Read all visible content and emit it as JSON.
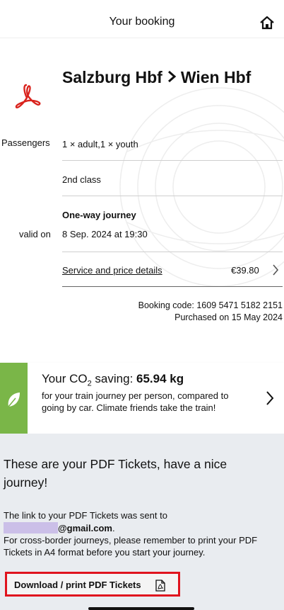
{
  "header": {
    "title": "Your booking",
    "home_icon": "home-icon"
  },
  "booking": {
    "from": "Salzburg Hbf",
    "to": "Wien Hbf",
    "passengers_label": "Passengers",
    "passengers_value": "1 × adult,1 × youth",
    "class": "2nd class",
    "journey_type": "One-way journey",
    "valid_label": "valid on",
    "valid_value": "8 Sep. 2024 at 19:30",
    "service_link": "Service and price details",
    "price": "€39.80",
    "booking_code": "Booking code: 1609 5471 5182 2151",
    "purchased": "Purchased on 15 May 2024"
  },
  "co2": {
    "title_prefix": "Your CO",
    "title_sub": "2",
    "title_mid": " saving: ",
    "amount": "65.94 kg",
    "description": "for your train journey per person, compared to going by car. Climate friends take the train!",
    "accent_color": "#7ab648"
  },
  "tickets": {
    "heading": "These are your PDF Tickets, have a nice journey!",
    "link_sent": "The link to your PDF Tickets was sent to",
    "email_domain": "@gmail.com",
    "email_suffix": ".",
    "cross_border": "For cross-border journeys, please remember to print your PDF Tickets in A4 format before you start your journey.",
    "download_label": "Download / print PDF Tickets",
    "highlight_color": "#e0141e"
  }
}
